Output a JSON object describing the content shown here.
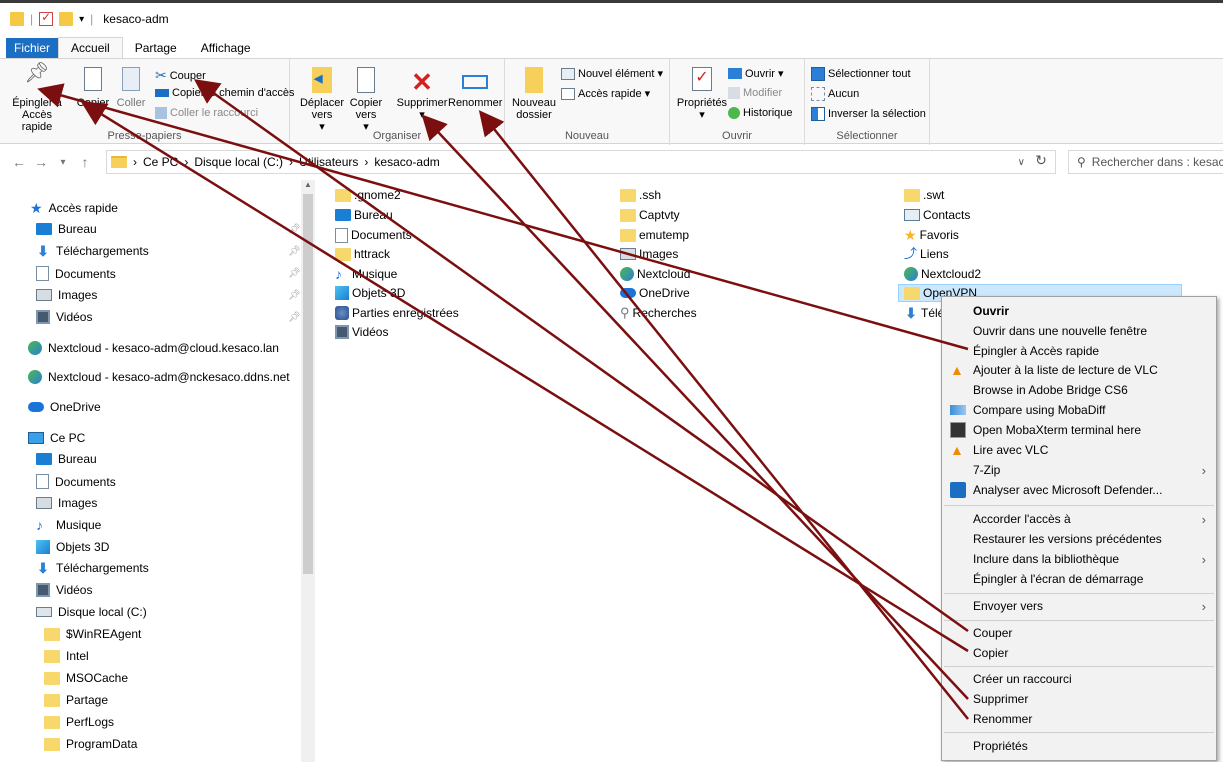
{
  "window": {
    "title": "kesaco-adm"
  },
  "ribbon_tabs": [
    "Fichier",
    "Accueil",
    "Partage",
    "Affichage"
  ],
  "clipboard": {
    "pin_label": "Épingler à Accès rapide",
    "copy_label": "Copier",
    "paste_label": "Coller",
    "cut_label": "Couper",
    "copy_path_label": "Copier le chemin d'accès",
    "paste_shortcut_label": "Coller le raccourci",
    "group_label": "Presse-papiers"
  },
  "organize": {
    "move_label": "Déplacer vers",
    "copy_to_label": "Copier vers",
    "delete_label": "Supprimer",
    "rename_label": "Renommer",
    "group_label": "Organiser"
  },
  "new": {
    "new_folder_label": "Nouveau dossier",
    "new_item_label": "Nouvel élément",
    "quick_access_label": "Accès rapide",
    "group_label": "Nouveau"
  },
  "open": {
    "properties_label": "Propriétés",
    "open_label": "Ouvrir",
    "edit_label": "Modifier",
    "history_label": "Historique",
    "group_label": "Ouvrir"
  },
  "select": {
    "select_all_label": "Sélectionner tout",
    "none_label": "Aucun",
    "invert_label": "Inverser la sélection",
    "group_label": "Sélectionner"
  },
  "address": {
    "crumbs": [
      "Ce PC",
      "Disque local (C:)",
      "Utilisateurs",
      "kesaco-adm"
    ],
    "search_placeholder": "Rechercher dans : kesaco-adm"
  },
  "nav": {
    "quick_access": "Accès rapide",
    "quick_items": [
      "Bureau",
      "Téléchargements",
      "Documents",
      "Images",
      "Vidéos"
    ],
    "nextcloud1": "Nextcloud - kesaco-adm@cloud.kesaco.lan",
    "nextcloud2": "Nextcloud - kesaco-adm@nckesaco.ddns.net",
    "onedrive": "OneDrive",
    "this_pc": "Ce PC",
    "pc_items": [
      "Bureau",
      "Documents",
      "Images",
      "Musique",
      "Objets 3D",
      "Téléchargements",
      "Vidéos"
    ],
    "drive": "Disque local (C:)",
    "drive_items": [
      "$WinREAgent",
      "Intel",
      "MSOCache",
      "Partage",
      "PerfLogs",
      "ProgramData"
    ]
  },
  "files": {
    "col1": [
      ".gnome2",
      "Bureau",
      "Documents",
      "httrack",
      "Musique",
      "Objets 3D",
      "Parties enregistrées",
      "Vidéos"
    ],
    "col2": [
      ".ssh",
      "Captvty",
      "emutemp",
      "Images",
      "Nextcloud",
      "OneDrive",
      "Recherches"
    ],
    "col3": [
      ".swt",
      "Contacts",
      "Favoris",
      "Liens",
      "Nextcloud2",
      "OpenVPN",
      "Téléchargements"
    ]
  },
  "context_menu": {
    "items": [
      "Ouvrir",
      "Ouvrir dans une nouvelle fenêtre",
      "Épingler à Accès rapide",
      "Ajouter à la liste de lecture de VLC",
      "Browse in Adobe Bridge CS6",
      "Compare using MobaDiff",
      "Open MobaXterm terminal here",
      "Lire avec VLC",
      "7-Zip",
      "Analyser avec Microsoft Defender...",
      "Accorder l'accès à",
      "Restaurer les versions précédentes",
      "Inclure dans la bibliothèque",
      "Épingler à l'écran de démarrage",
      "Envoyer vers",
      "Couper",
      "Copier",
      "Créer un raccourci",
      "Supprimer",
      "Renommer",
      "Propriétés"
    ]
  },
  "colors": {
    "arrow": "#7b0f0f",
    "accent": "#1b6ec2",
    "selection": "#cce8ff"
  }
}
